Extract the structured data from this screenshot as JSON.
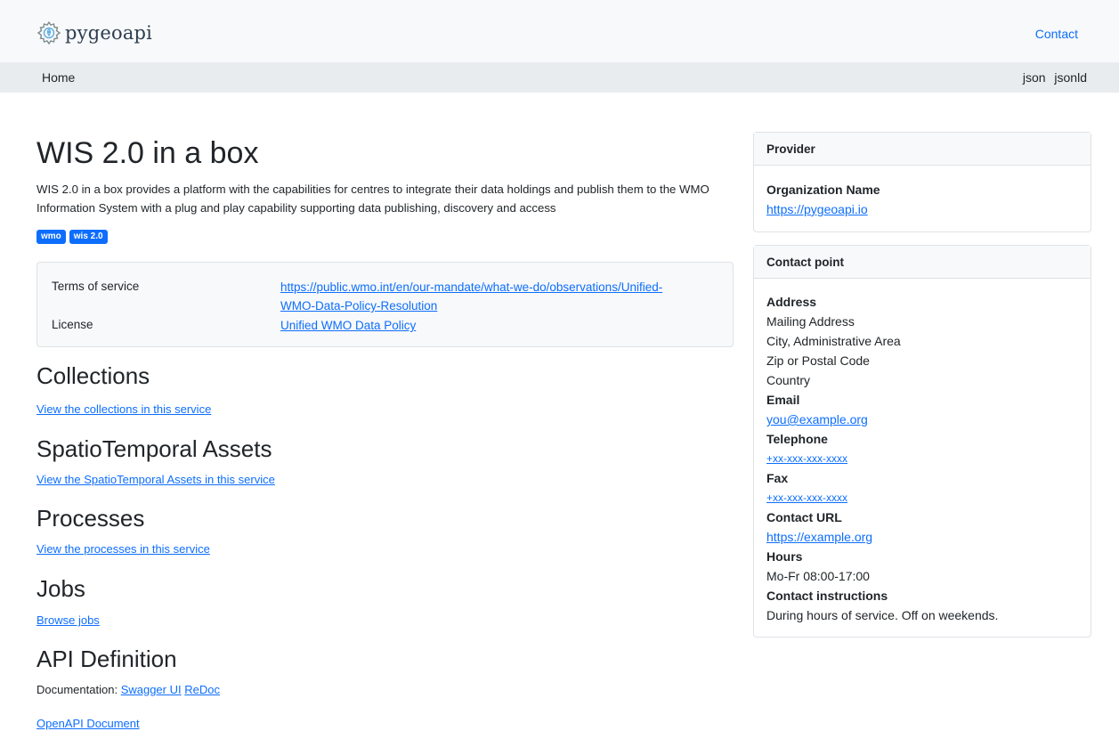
{
  "header": {
    "logo_text": "pygeoapi",
    "contact_label": "Contact"
  },
  "nav": {
    "home_label": "Home",
    "formats": [
      "json",
      "jsonld"
    ]
  },
  "main": {
    "title": "WIS 2.0 in a box",
    "description": "WIS 2.0 in a box provides a platform with the capabilities for centres to integrate their data holdings and publish them to the WMO Information System with a plug and play capability supporting data publishing, discovery and access",
    "keywords": [
      "wmo",
      "wis 2.0"
    ],
    "terms": {
      "tos_label": "Terms of service",
      "tos_value_line1": "https://public.wmo.int/en/our-mandate/what-we-do/observations/Unified-",
      "tos_value_line2": "WMO-Data-Policy-Resolution",
      "license_label": "License",
      "license_value": "Unified WMO Data Policy"
    },
    "sections": {
      "collections_title": "Collections",
      "collections_link": "View the collections in this service",
      "stac_title": "SpatioTemporal Assets",
      "stac_link": "View the SpatioTemporal Assets in this service",
      "processes_title": "Processes",
      "processes_link": "View the processes in this service",
      "jobs_title": "Jobs",
      "jobs_link": "Browse jobs",
      "api_title": "API Definition",
      "doc_label": "Documentation:",
      "swagger_link": "Swagger UI",
      "redoc_link": "ReDoc",
      "openapi_link": "OpenAPI Document"
    }
  },
  "provider": {
    "header": "Provider",
    "org_label": "Organization Name",
    "org_url": "https://pygeoapi.io"
  },
  "contact_point": {
    "header": "Contact point",
    "address_label": "Address",
    "address_lines": [
      "Mailing Address",
      "City, Administrative Area",
      "Zip or Postal Code",
      "Country"
    ],
    "email_label": "Email",
    "email": "you@example.org",
    "telephone_label": "Telephone",
    "telephone": "+xx-xxx-xxx-xxxx",
    "fax_label": "Fax",
    "fax": "+xx-xxx-xxx-xxxx",
    "url_label": "Contact URL",
    "url": "https://example.org",
    "hours_label": "Hours",
    "hours": "Mo-Fr 08:00-17:00",
    "instructions_label": "Contact instructions",
    "instructions": "During hours of service. Off on weekends."
  },
  "colors": {
    "link": "#0d6efd",
    "badge": "#0d6efd",
    "topbar": "#f8f9fa",
    "navbar": "#e9ecef"
  }
}
